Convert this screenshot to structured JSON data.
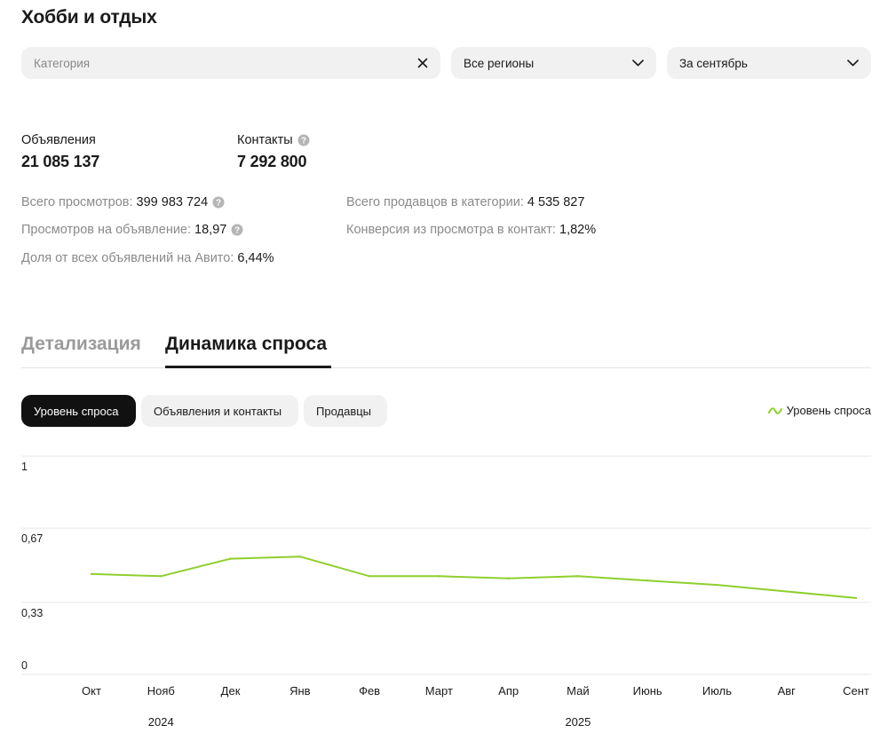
{
  "header": {
    "title": "Хобби и отдых"
  },
  "filters": {
    "category_placeholder": "Категория",
    "region": "Все регионы",
    "period": "За сентябрь"
  },
  "kpis": {
    "listings_label": "Объявления",
    "listings_value": "21 085 137",
    "contacts_label": "Контакты",
    "contacts_value": "7 292 800"
  },
  "stats": {
    "total_views_label": "Всего просмотров:",
    "total_views_value": "399 983 724",
    "views_per_listing_label": "Просмотров на объявление:",
    "views_per_listing_value": "18,97",
    "share_label": "Доля от всех объявлений на Авито:",
    "share_value": "6,44%",
    "sellers_label": "Всего продавцов в категории:",
    "sellers_value": "4 535 827",
    "conversion_label": "Конверсия из просмотра в контакт:",
    "conversion_value": "1,82%"
  },
  "tabs": {
    "details": "Детализация",
    "demand": "Динамика спроса"
  },
  "pills": {
    "demand_level": "Уровень спроса",
    "listings_contacts": "Объявления и контакты",
    "sellers": "Продавцы"
  },
  "colors": {
    "accent": "#8fcf2e",
    "active_pill": "#111111",
    "filter_bg": "#f1f1f1"
  },
  "chart_data": {
    "type": "line",
    "categories": [
      "Окт",
      "Нояб",
      "Дек",
      "Янв",
      "Фев",
      "Март",
      "Апр",
      "Май",
      "Июнь",
      "Июль",
      "Авг",
      "Сент"
    ],
    "year_labels": [
      {
        "label": "2024",
        "category": "Нояб"
      },
      {
        "label": "2025",
        "category": "Май"
      }
    ],
    "series": [
      {
        "name": "Уровень спроса",
        "values": [
          0.46,
          0.45,
          0.53,
          0.54,
          0.45,
          0.45,
          0.44,
          0.45,
          0.43,
          0.41,
          0.38,
          0.35
        ]
      }
    ],
    "yticks": [
      {
        "value": 1,
        "label": "1"
      },
      {
        "value": 0.67,
        "label": "0,67"
      },
      {
        "value": 0.33,
        "label": "0,33"
      },
      {
        "value": 0,
        "label": "0"
      }
    ],
    "ylim": [
      0,
      1
    ],
    "grid": true,
    "legend": "top-right"
  }
}
